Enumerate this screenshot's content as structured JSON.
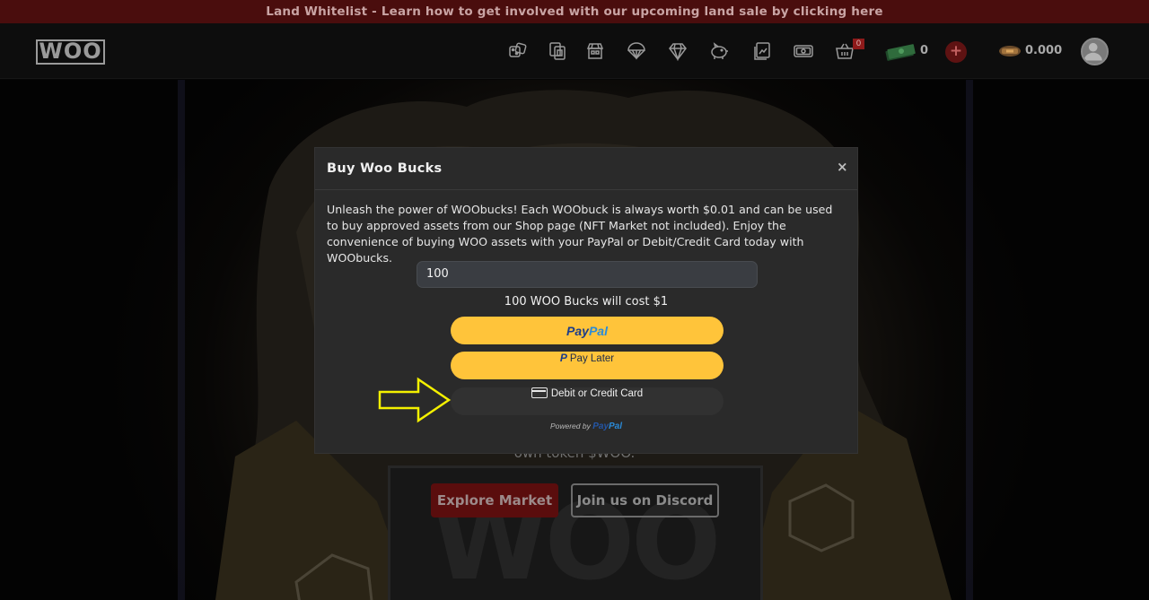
{
  "banner": {
    "text": "Land Whitelist - Learn how to get involved with our upcoming land sale by clicking here"
  },
  "header": {
    "logo_text": "WOO",
    "nav_icons": [
      "dice-icon",
      "cards-icon",
      "shop-icon",
      "airdrop-icon",
      "diamond-icon",
      "piggy-bank-icon",
      "collection-icon",
      "money-icon",
      "cart-icon"
    ],
    "cart_count": "0",
    "woo_bucks_balance": "0",
    "add_button": "+",
    "token_balance": "0.000"
  },
  "hero": {
    "caption": "own token $WOO.",
    "watermark": "WOO",
    "explore_button": "Explore Market",
    "discord_button": "Join us on Discord"
  },
  "modal": {
    "title": "Buy Woo Bucks",
    "close": "×",
    "description": "Unleash the power of WOObucks! Each WOObuck is always worth $0.01 and can be used to buy approved assets from our Shop page (NFT Market not included). Enjoy the convenience of buying WOO assets with your PayPal or Debit/Credit Card today with WOObucks.",
    "amount_value": "100",
    "cost_text": "100 WOO Bucks will cost $1",
    "paypal_button": {
      "pay": "Pay",
      "pal": "Pal"
    },
    "pay_later_button": {
      "glyph": "P",
      "label": "Pay Later"
    },
    "card_button": {
      "label": "Debit or Credit Card"
    },
    "powered_by": {
      "prefix": "Powered by",
      "brand_pay": "Pay",
      "brand_pal": "Pal"
    }
  },
  "colors": {
    "accent_red": "#8d1a1a",
    "paypal_yellow": "#ffc43a",
    "arrow_yellow": "#f4f000"
  }
}
